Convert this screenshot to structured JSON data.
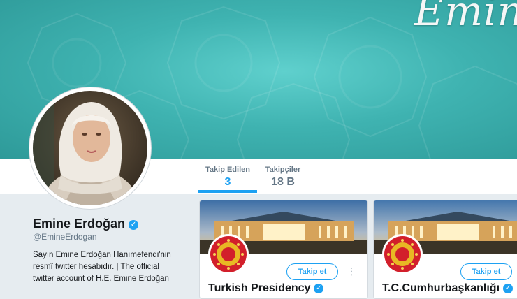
{
  "banner": {
    "script_text": "Emin",
    "colors": {
      "teal_light": "#5fd0cd",
      "teal_dark": "#2e9a99"
    }
  },
  "nav": {
    "following": {
      "label": "Takip Edilen",
      "value": "3"
    },
    "followers": {
      "label": "Takipçiler",
      "value": "18 B"
    },
    "accent": "#1da1f2"
  },
  "profile": {
    "name": "Emine Erdoğan",
    "handle": "@EmineErdogan",
    "bio_lines": [
      "Sayın Emine Erdoğan Hanımefendi'nin",
      "resmî twitter hesabıdır. | The official",
      "twitter account of H.E. Emine Erdoğan"
    ],
    "verified_icon": "verified-badge-icon"
  },
  "cards": [
    {
      "name": "Turkish Presidency",
      "button": "Takip et",
      "verified": true
    },
    {
      "name": "T.C.Cumhurbaşkanlığı",
      "button": "Takip et",
      "verified": true
    }
  ]
}
